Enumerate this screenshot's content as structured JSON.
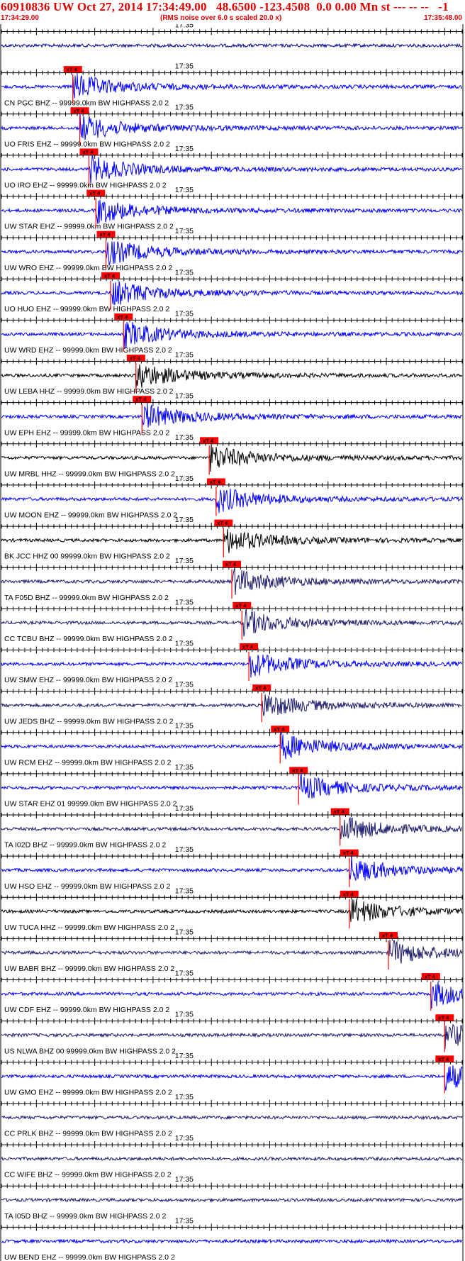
{
  "header": {
    "title": "60910836 UW Oct 27, 2014 17:34:49.00   48.6500 -123.4508  0.0 0.00 Mn st --- -- --   -1",
    "start_time": "17:34:29.00",
    "noise_note": "(RMS noise over 6.0 s scaled 20.0 x)",
    "end_time": "17:35:48.00"
  },
  "chart_data": {
    "type": "line",
    "title": "60910836 UW Oct 27, 2014 17:34:49.00   48.6500 -123.4508  0.0 0.00 Mn st --- -- --   -1",
    "x_range": [
      "17:34:29.00",
      "17:35:48.00"
    ],
    "x_tick_label": "17:35",
    "pick_label": "xT 4",
    "traces": [
      {
        "label": "",
        "color": "#00008b",
        "pick": null
      },
      {
        "label": "CN PGC BHZ -- 99999.0km BW  HIGHPASS  2.0  2",
        "color": "#0000ff",
        "pick": 0.155
      },
      {
        "label": "UO FRIS EHZ -- 99999.0km BW  HIGHPASS  2.0  2",
        "color": "#0000ff",
        "pick": 0.17
      },
      {
        "label": "UO IRO EHZ -- 99999.0km BW  HIGHPASS  2.0  2",
        "color": "#0000ff",
        "pick": 0.19
      },
      {
        "label": "UW STAR EHZ -- 99999.0km BW  HIGHPASS  2.0  2",
        "color": "#0000ff",
        "pick": 0.205
      },
      {
        "label": "UW WRO EHZ -- 99999.0km BW  HIGHPASS  2.0  2",
        "color": "#0000ff",
        "pick": 0.227
      },
      {
        "label": "UO HUO EHZ -- 99999.0km BW  HIGHPASS  2.0  2",
        "color": "#0000ff",
        "pick": 0.237
      },
      {
        "label": "UW WRD EHZ -- 99999.0km BW  HIGHPASS  2.0  2",
        "color": "#0000ff",
        "pick": 0.265
      },
      {
        "label": "UW LEBA HHZ -- 99999.0km BW  HIGHPASS  2.0  2",
        "color": "#000000",
        "pick": 0.292
      },
      {
        "label": "UW EPH EHZ -- 99999.0km BW  HIGHPASS  2.0  2",
        "color": "#0000ff",
        "pick": 0.305
      },
      {
        "label": "UW MRBL HHZ -- 99999.0km BW  HIGHPASS  2.0  2",
        "color": "#000000",
        "pick": 0.451
      },
      {
        "label": "UW MOON EHZ -- 99999.0km BW  HIGHPASS  2.0  2",
        "color": "#0000ff",
        "pick": 0.466
      },
      {
        "label": "BK JCC HHZ 00 99999.0km BW  HIGHPASS  2.0  2",
        "color": "#000000",
        "pick": 0.482
      },
      {
        "label": "TA F05D BHZ -- 99999.0km BW  HIGHPASS  2.0  2",
        "color": "#1a1a6e",
        "pick": 0.5
      },
      {
        "label": "CC TCBU BHZ -- 99999.0km BW  HIGHPASS  2.0  2",
        "color": "#1a1a6e",
        "pick": 0.522
      },
      {
        "label": "UW SMW EHZ -- 99999.0km BW  HIGHPASS  2.0  2",
        "color": "#0000ff",
        "pick": 0.537
      },
      {
        "label": "UW JEDS BHZ -- 99999.0km BW  HIGHPASS  2.0  2",
        "color": "#1a1a6e",
        "pick": 0.565
      },
      {
        "label": "UW RCM EHZ -- 99999.0km BW  HIGHPASS  2.0  2",
        "color": "#0000ff",
        "pick": 0.605
      },
      {
        "label": "UW STAR EHZ 01 99999.0km BW  HIGHPASS  2.0  2",
        "color": "#0000ff",
        "pick": 0.645
      },
      {
        "label": "TA I02D BHZ -- 99999.0km BW  HIGHPASS  2.0  2",
        "color": "#1a1a6e",
        "pick": 0.735
      },
      {
        "label": "UW HSO EHZ -- 99999.0km BW  HIGHPASS  2.0  2",
        "color": "#0000ff",
        "pick": 0.755
      },
      {
        "label": "UW TUCA HHZ -- 99999.0km BW  HIGHPASS  2.0  2",
        "color": "#000000",
        "pick": 0.755
      },
      {
        "label": "UW BABR BHZ -- 99999.0km BW  HIGHPASS  2.0  2",
        "color": "#1a1a6e",
        "pick": 0.84
      },
      {
        "label": "UW CDF EHZ -- 99999.0km BW  HIGHPASS  2.0  2",
        "color": "#0000ff",
        "pick": 0.932
      },
      {
        "label": "US NLWA BHZ 00 99999.0km BW  HIGHPASS  2.0  2",
        "color": "#1a1a6e",
        "pick": 0.962
      },
      {
        "label": "UW GMO EHZ -- 99999.0km BW  HIGHPASS  2.0  2",
        "color": "#0000ff",
        "pick": 0.962
      },
      {
        "label": "CC PRLK BHZ -- 99999.0km BW  HIGHPASS  2.0  2",
        "color": "#1a1a6e",
        "pick": null
      },
      {
        "label": "CC WIFE BHZ -- 99999.0km BW  HIGHPASS  2.0  2",
        "color": "#1a1a6e",
        "pick": null
      },
      {
        "label": "TA I05D BHZ -- 99999.0km BW  HIGHPASS  2.0  2",
        "color": "#1a1a6e",
        "pick": null
      },
      {
        "label": "UW BEND EHZ -- 99999.0km BW  HIGHPASS  2.0  2",
        "color": "#0000ff",
        "pick": null
      }
    ]
  }
}
